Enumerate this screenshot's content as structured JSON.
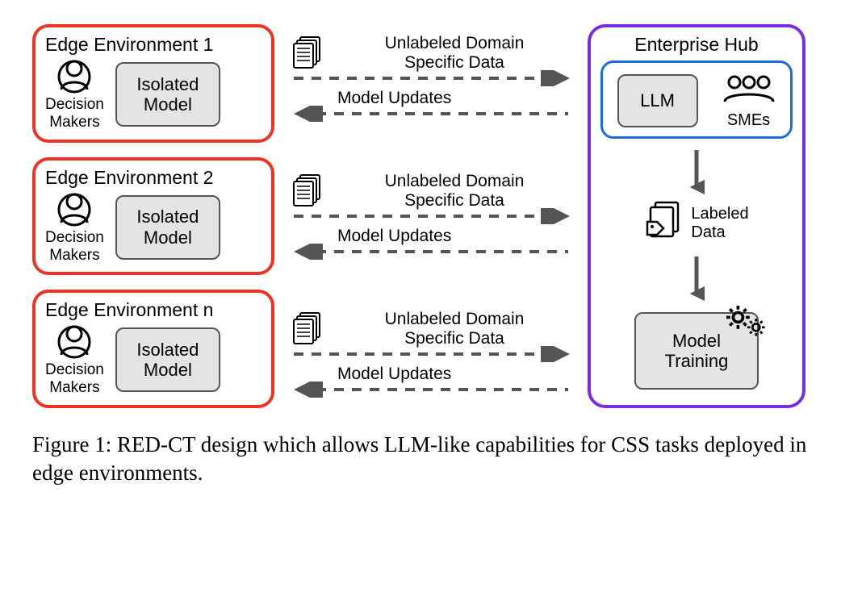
{
  "edge_envs": [
    {
      "title": "Edge Environment 1",
      "actor": "Decision\nMakers",
      "model": "Isolated\nModel"
    },
    {
      "title": "Edge Environment 2",
      "actor": "Decision\nMakers",
      "model": "Isolated\nModel"
    },
    {
      "title": "Edge Environment n",
      "actor": "Decision\nMakers",
      "model": "Isolated\nModel"
    }
  ],
  "exchange": {
    "to_hub": "Unlabeled Domain\nSpecific Data",
    "from_hub": "Model Updates"
  },
  "hub": {
    "title": "Enterprise Hub",
    "llm": "LLM",
    "smes": "SMEs",
    "labeled": "Labeled\nData",
    "training": "Model\nTraining"
  },
  "caption": "Figure 1: RED-CT design which allows LLM-like capabilities for CSS tasks deployed in edge environments."
}
